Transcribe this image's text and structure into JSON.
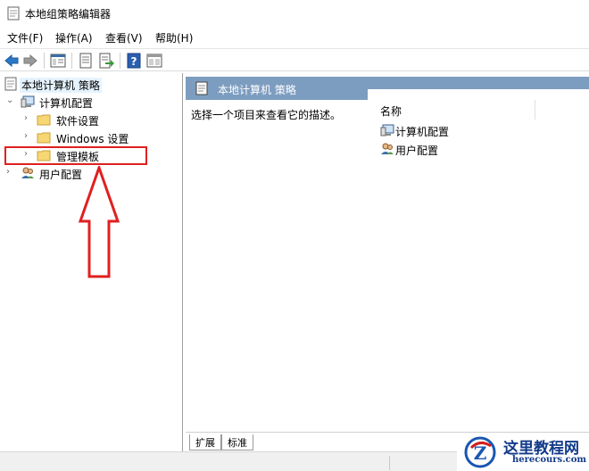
{
  "window": {
    "title": "本地组策略编辑器"
  },
  "menu": {
    "items": [
      "文件(F)",
      "操作(A)",
      "查看(V)",
      "帮助(H)"
    ]
  },
  "tree": {
    "root": "本地计算机 策略",
    "computer_config": "计算机配置",
    "software_settings": "软件设置",
    "windows_settings": "Windows 设置",
    "admin_templates": "管理模板",
    "user_config": "用户配置"
  },
  "right": {
    "header": "本地计算机 策略",
    "description": "选择一个项目来查看它的描述。",
    "column_name": "名称",
    "items": [
      "计算机配置",
      "用户配置"
    ]
  },
  "tabs": {
    "extended": "扩展",
    "standard": "标准"
  },
  "watermark": {
    "title": "这里教程网",
    "url": "herecours.com"
  },
  "colors": {
    "header_bg": "#7d9dc0",
    "annotation": "#e02020",
    "selection": "#e5f3ff",
    "watermark": "#123a8a"
  },
  "icons": [
    "policy-icon",
    "back-arrow-icon",
    "forward-arrow-icon",
    "show-tree-icon",
    "properties-icon",
    "export-list-icon",
    "help-icon",
    "extended-view-icon",
    "folder-icon",
    "computer-icon",
    "users-icon"
  ]
}
